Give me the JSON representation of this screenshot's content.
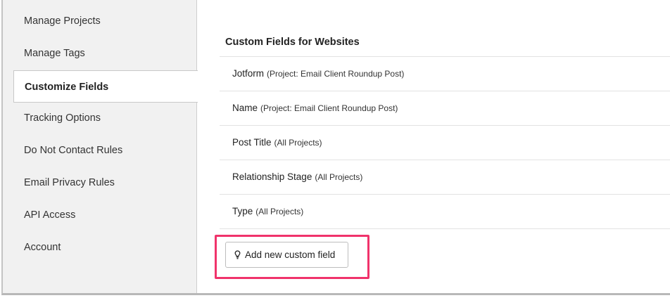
{
  "sidebar": {
    "items": [
      {
        "label": "Manage Projects"
      },
      {
        "label": "Manage Tags"
      },
      {
        "label": "Customize Fields",
        "active": true
      },
      {
        "label": "Tracking Options"
      },
      {
        "label": "Do Not Contact Rules"
      },
      {
        "label": "Email Privacy Rules"
      },
      {
        "label": "API Access"
      },
      {
        "label": "Account"
      }
    ]
  },
  "main": {
    "title": "Custom Fields for Websites",
    "fields": [
      {
        "name": "Jotform",
        "scope": "(Project: Email Client Roundup Post)"
      },
      {
        "name": "Name",
        "scope": "(Project: Email Client Roundup Post)"
      },
      {
        "name": "Post Title",
        "scope": "(All Projects)"
      },
      {
        "name": "Relationship Stage",
        "scope": "(All Projects)"
      },
      {
        "name": "Type",
        "scope": "(All Projects)"
      }
    ],
    "add_button": {
      "label": "Add new custom field",
      "icon": "lightbulb-icon"
    }
  },
  "colors": {
    "highlight": "#f0336b"
  }
}
